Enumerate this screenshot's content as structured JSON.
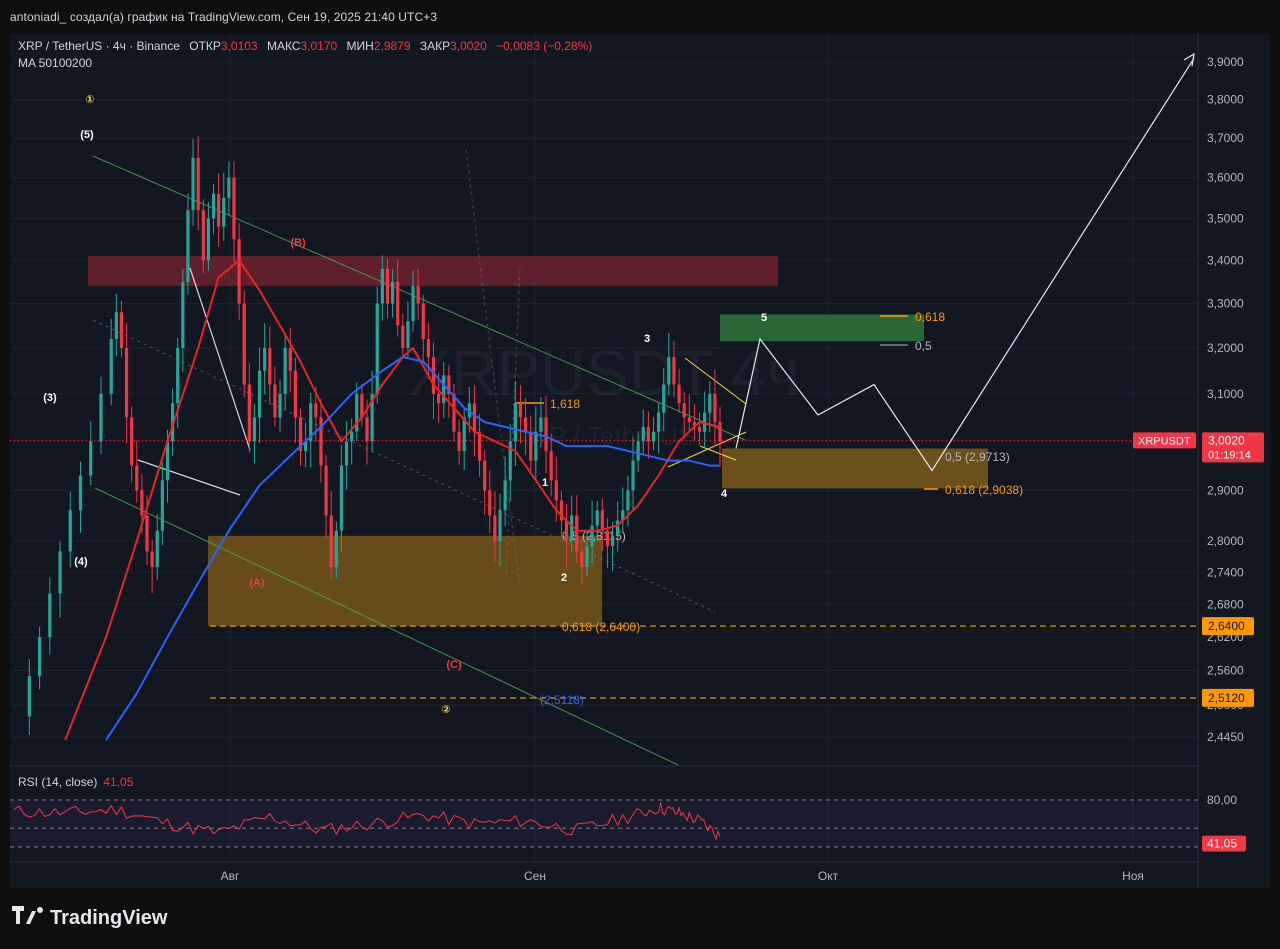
{
  "header": {
    "caption": "antoniadi_ создал(а) график на TradingView.com, Сен 19, 2025 21:40 UTC+3"
  },
  "legend": {
    "symbol": "XRP / TetherUS · 4ч · Binance",
    "open_label": "ОТКР",
    "open": "3,0103",
    "high_label": "МАКС",
    "high": "3,0170",
    "low_label": "МИН",
    "low": "2,9879",
    "close_label": "ЗАКР",
    "close": "3,0020",
    "change": "−0,0083 (−0,28%)",
    "ma": "MA 50100200"
  },
  "watermark": {
    "big": "XRPUSDT 4ч",
    "small": "XRP / TetherUS"
  },
  "rsi_legend": {
    "title": "RSI (14, close)",
    "value": "41,05"
  },
  "footer": {
    "brand": "TradingView"
  },
  "colors": {
    "background": "#131722",
    "bear": "#f23645",
    "ma50": "#e62626",
    "ma100": "#2962ff",
    "rsi": "#f23645",
    "fib_orange": "#ff9800",
    "resistance_zone": "#7a2430",
    "support_zone": "#8a6418",
    "target_zone": "#2f6f3a"
  },
  "chart_data": {
    "type": "candlestick",
    "title": "XRP / TetherUS · 4ч · Binance",
    "timeframe": "4ч",
    "yscale": "log",
    "ylim": [
      2.375,
      3.95
    ],
    "x_ticks": [
      "Авг",
      "Сен",
      "Окт",
      "Ноя"
    ],
    "y_ticks": [
      "3,9000",
      "3,8000",
      "3,7000",
      "3,6000",
      "3,5000",
      "3,4000",
      "3,3000",
      "3,2000",
      "3,1000",
      "3,0000",
      "2,9000",
      "2,8000",
      "2,7400",
      "2,6800",
      "2,6200",
      "2,5600",
      "2,5000",
      "2,4450"
    ],
    "last_price": {
      "label": "XRPUSDT",
      "value": "3,0020",
      "countdown": "01:19:14"
    },
    "price_lines": [
      {
        "value": "2,6400",
        "price": 2.64
      },
      {
        "value": "2,5120",
        "price": 2.512
      }
    ],
    "price_path": [
      [
        0,
        2.48
      ],
      [
        3,
        2.55
      ],
      [
        5,
        2.62
      ],
      [
        7,
        2.7
      ],
      [
        9,
        2.78
      ],
      [
        11,
        2.86
      ],
      [
        13,
        2.93
      ],
      [
        15,
        3.0
      ],
      [
        17,
        3.1
      ],
      [
        19,
        3.22
      ],
      [
        20,
        3.28
      ],
      [
        21,
        3.2
      ],
      [
        22,
        3.05
      ],
      [
        23,
        2.95
      ],
      [
        24,
        2.9
      ],
      [
        25,
        2.85
      ],
      [
        26,
        2.78
      ],
      [
        27,
        2.75
      ],
      [
        28,
        2.82
      ],
      [
        29,
        2.92
      ],
      [
        30,
        3.0
      ],
      [
        31,
        3.08
      ],
      [
        32,
        3.2
      ],
      [
        33,
        3.35
      ],
      [
        34,
        3.52
      ],
      [
        35,
        3.65
      ],
      [
        36,
        3.52
      ],
      [
        37,
        3.4
      ],
      [
        38,
        3.5
      ],
      [
        39,
        3.56
      ],
      [
        40,
        3.48
      ],
      [
        41,
        3.55
      ],
      [
        42,
        3.6
      ],
      [
        43,
        3.45
      ],
      [
        44,
        3.3
      ],
      [
        45,
        3.12
      ],
      [
        46,
        3.0
      ],
      [
        47,
        3.05
      ],
      [
        48,
        3.15
      ],
      [
        49,
        3.2
      ],
      [
        50,
        3.12
      ],
      [
        51,
        3.05
      ],
      [
        52,
        3.1
      ],
      [
        53,
        3.2
      ],
      [
        54,
        3.15
      ],
      [
        55,
        3.05
      ],
      [
        56,
        2.98
      ],
      [
        57,
        3.0
      ],
      [
        58,
        3.08
      ],
      [
        59,
        3.05
      ],
      [
        60,
        2.95
      ],
      [
        61,
        2.85
      ],
      [
        62,
        2.75
      ],
      [
        63,
        2.82
      ],
      [
        64,
        2.95
      ],
      [
        65,
        3.0
      ],
      [
        66,
        3.02
      ],
      [
        67,
        3.1
      ],
      [
        68,
        3.05
      ],
      [
        69,
        3.0
      ],
      [
        70,
        3.1
      ],
      [
        71,
        3.3
      ],
      [
        72,
        3.38
      ],
      [
        73,
        3.3
      ],
      [
        74,
        3.35
      ],
      [
        75,
        3.25
      ],
      [
        76,
        3.2
      ],
      [
        77,
        3.26
      ],
      [
        78,
        3.34
      ],
      [
        79,
        3.3
      ],
      [
        80,
        3.22
      ],
      [
        81,
        3.18
      ],
      [
        82,
        3.1
      ],
      [
        83,
        3.08
      ],
      [
        84,
        3.14
      ],
      [
        85,
        3.1
      ],
      [
        86,
        3.02
      ],
      [
        87,
        2.98
      ],
      [
        88,
        3.05
      ],
      [
        89,
        3.08
      ],
      [
        90,
        3.02
      ],
      [
        91,
        2.96
      ],
      [
        92,
        2.9
      ],
      [
        93,
        2.85
      ],
      [
        94,
        2.8
      ],
      [
        95,
        2.86
      ],
      [
        96,
        2.92
      ],
      [
        97,
        3.0
      ],
      [
        98,
        3.08
      ],
      [
        99,
        3.05
      ],
      [
        100,
        3.02
      ],
      [
        101,
        2.96
      ],
      [
        102,
        3.02
      ],
      [
        103,
        3.05
      ],
      [
        104,
        2.98
      ],
      [
        105,
        2.92
      ],
      [
        106,
        2.88
      ],
      [
        107,
        2.84
      ],
      [
        108,
        2.8
      ],
      [
        109,
        2.85
      ],
      [
        110,
        2.78
      ],
      [
        111,
        2.75
      ],
      [
        112,
        2.79
      ],
      [
        113,
        2.83
      ],
      [
        114,
        2.86
      ],
      [
        115,
        2.82
      ],
      [
        116,
        2.79
      ],
      [
        117,
        2.81
      ],
      [
        118,
        2.84
      ],
      [
        119,
        2.86
      ],
      [
        120,
        2.9
      ],
      [
        121,
        2.96
      ],
      [
        122,
        3.0
      ],
      [
        123,
        3.03
      ],
      [
        124,
        3.0
      ],
      [
        125,
        3.02
      ],
      [
        126,
        3.06
      ],
      [
        127,
        3.12
      ],
      [
        128,
        3.18
      ],
      [
        129,
        3.12
      ],
      [
        130,
        3.08
      ],
      [
        131,
        3.05
      ],
      [
        132,
        3.04
      ],
      [
        133,
        3.03
      ],
      [
        134,
        3.02
      ],
      [
        135,
        3.06
      ],
      [
        136,
        3.1
      ],
      [
        137,
        3.04
      ],
      [
        138,
        3.0
      ]
    ],
    "ma50": [
      [
        10,
        2.44
      ],
      [
        18,
        2.62
      ],
      [
        24,
        2.8
      ],
      [
        30,
        3.0
      ],
      [
        36,
        3.2
      ],
      [
        40,
        3.36
      ],
      [
        44,
        3.4
      ],
      [
        48,
        3.33
      ],
      [
        52,
        3.25
      ],
      [
        56,
        3.17
      ],
      [
        60,
        3.08
      ],
      [
        64,
        3.0
      ],
      [
        68,
        3.05
      ],
      [
        72,
        3.12
      ],
      [
        76,
        3.18
      ],
      [
        78,
        3.2
      ],
      [
        82,
        3.12
      ],
      [
        86,
        3.07
      ],
      [
        90,
        3.02
      ],
      [
        94,
        3.0
      ],
      [
        98,
        2.98
      ],
      [
        102,
        2.92
      ],
      [
        106,
        2.86
      ],
      [
        110,
        2.82
      ],
      [
        114,
        2.82
      ],
      [
        118,
        2.83
      ],
      [
        122,
        2.87
      ],
      [
        126,
        2.93
      ],
      [
        130,
        3.0
      ],
      [
        134,
        3.04
      ],
      [
        138,
        3.03
      ]
    ],
    "ma100": [
      [
        18,
        2.44
      ],
      [
        24,
        2.52
      ],
      [
        30,
        2.62
      ],
      [
        36,
        2.72
      ],
      [
        42,
        2.82
      ],
      [
        48,
        2.91
      ],
      [
        54,
        2.97
      ],
      [
        60,
        3.03
      ],
      [
        66,
        3.1
      ],
      [
        72,
        3.15
      ],
      [
        76,
        3.18
      ],
      [
        80,
        3.17
      ],
      [
        84,
        3.12
      ],
      [
        88,
        3.07
      ],
      [
        92,
        3.04
      ],
      [
        96,
        3.03
      ],
      [
        100,
        3.02
      ],
      [
        104,
        3.01
      ],
      [
        108,
        2.99
      ],
      [
        112,
        2.99
      ],
      [
        116,
        2.99
      ],
      [
        120,
        2.98
      ],
      [
        124,
        2.97
      ],
      [
        128,
        2.96
      ],
      [
        132,
        2.96
      ],
      [
        136,
        2.95
      ],
      [
        138,
        2.95
      ]
    ],
    "rsi": [
      [
        0,
        68
      ],
      [
        10,
        66
      ],
      [
        20,
        70
      ],
      [
        30,
        55
      ],
      [
        40,
        45
      ],
      [
        50,
        62
      ],
      [
        60,
        48
      ],
      [
        70,
        55
      ],
      [
        80,
        64
      ],
      [
        90,
        55
      ],
      [
        100,
        58
      ],
      [
        110,
        48
      ],
      [
        120,
        62
      ],
      [
        126,
        72
      ],
      [
        130,
        66
      ],
      [
        134,
        58
      ],
      [
        138,
        41.05
      ]
    ],
    "rsi_ticks": [
      "80,00"
    ],
    "rsi_last": "41,05",
    "projection": [
      [
        2.985
      ],
      [
        3.22
      ],
      [
        3.055
      ],
      [
        3.12
      ],
      [
        2.94
      ],
      [
        3.91
      ]
    ],
    "zones": [
      {
        "name": "resistance",
        "top": 3.41,
        "bottom": 3.34
      },
      {
        "name": "support",
        "top": 2.81,
        "bottom": 2.64,
        "fib_label": "0,5 (2,8115)",
        "fib_label_2": "0,618 (2,6400)"
      },
      {
        "name": "target-wave5",
        "top": 3.275,
        "bottom": 3.215
      },
      {
        "name": "target-wave4",
        "top": 2.985,
        "bottom": 2.9038,
        "fib_label": "0,5 (2,9713)",
        "fib_label_2": "0,618 (2,9038)"
      }
    ],
    "fib_labels": [
      "1,618",
      "0,618",
      "0,5",
      "(2,5118)"
    ],
    "wave_labels": [
      "①",
      "(5)",
      "(3)",
      "(4)",
      "(B)",
      "(A)",
      "(C)",
      "②",
      "1",
      "2",
      "3",
      "4",
      "5"
    ]
  }
}
